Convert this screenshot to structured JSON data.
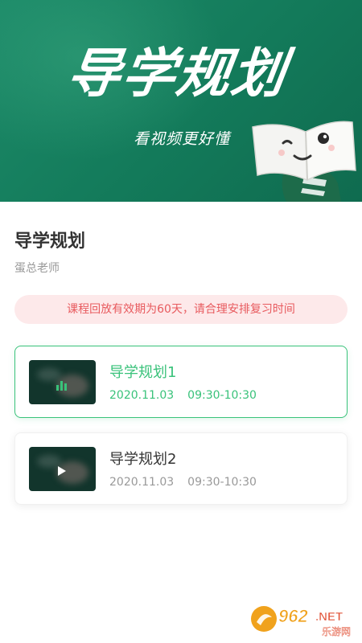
{
  "banner": {
    "title": "导学规划",
    "subtitle": "看视频更好懂"
  },
  "course": {
    "title": "导学规划",
    "teacher": "蛋总老师"
  },
  "notice": "课程回放有效期为60天，请合理安排复习时间",
  "lessons": [
    {
      "title": "导学规划1",
      "date": "2020.11.03",
      "time": "09:30-10:30",
      "state": "playing",
      "icon": "playing-bars-icon"
    },
    {
      "title": "导学规划2",
      "date": "2020.11.03",
      "time": "09:30-10:30",
      "state": "idle",
      "icon": "play-icon"
    }
  ],
  "watermark": {
    "brand": "962",
    "suffix": ".NET",
    "caption": "乐游网"
  },
  "colors": {
    "banner": "#137a5a",
    "accent": "#39c27a",
    "notice_bg": "#fde9ea",
    "notice_text": "#e85a5e"
  }
}
